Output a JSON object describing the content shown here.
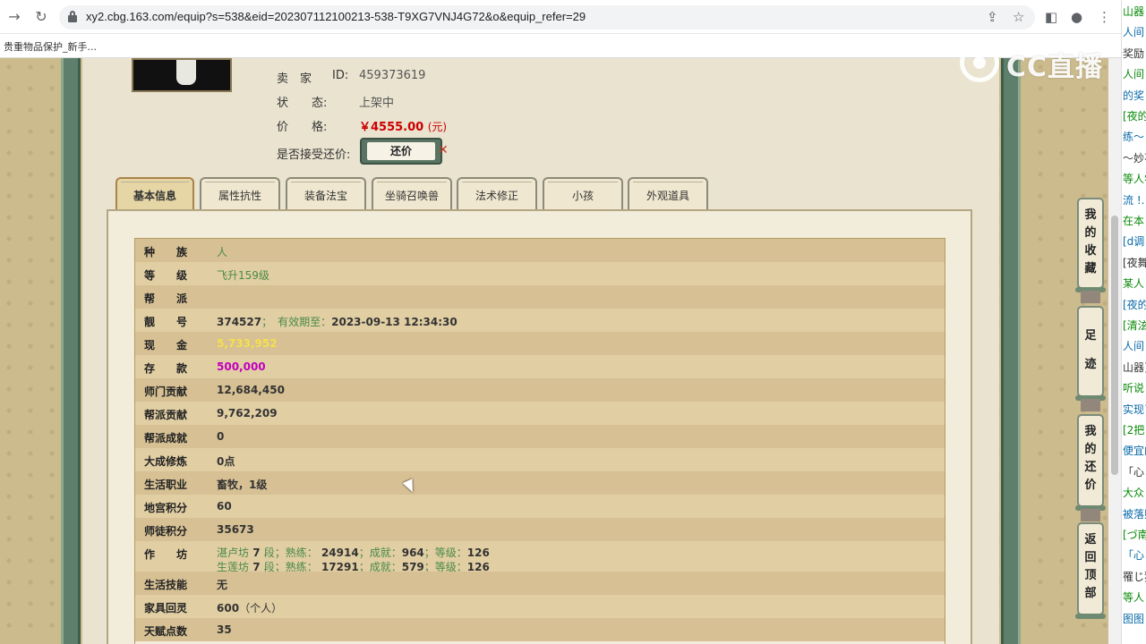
{
  "browser": {
    "url": "xy2.cbg.163.com/equip?s=538&eid=202307112100213-538-T9XG7VNJ4G72&o&equip_refer=29",
    "bookmark": "贵重物品保护_新手..."
  },
  "seller": {
    "seller_label": "卖　家",
    "id_label": "ID:",
    "id_value": "459373619",
    "status_label": "状　　态:",
    "status_value": "上架中",
    "price_label": "价　　格:",
    "price_value": "￥4555.00",
    "price_unit": "(元)",
    "counter_label": "是否接受还价:",
    "counter_button": "还价",
    "counter_x": "✕"
  },
  "tabs": [
    {
      "label": "基本信息",
      "active": true
    },
    {
      "label": "属性抗性"
    },
    {
      "label": "装备法宝"
    },
    {
      "label": "坐骑召唤兽"
    },
    {
      "label": "法术修正"
    },
    {
      "label": "小孩"
    },
    {
      "label": "外观道具"
    }
  ],
  "basic_info": {
    "race_label": "种　　族",
    "race_value": "人",
    "level_label": "等　　级",
    "level_value": "飞升159级",
    "guild_label": "帮　　派",
    "guild_value": "",
    "lucky_label": "靓　　号",
    "lucky_value": "374527",
    "lucky_valid_label": "；　有效期至：",
    "lucky_valid_value": "2023-09-13 12:34:30",
    "cash_label": "现　　金",
    "cash_value": "5,733,952",
    "deposit_label": "存　　款",
    "deposit_value": "500,000",
    "school_contrib_label": "师门贡献",
    "school_contrib_value": "12,684,450",
    "guild_contrib_label": "帮派贡献",
    "guild_contrib_value": "9,762,209",
    "guild_achieve_label": "帮派成就",
    "guild_achieve_value": "0",
    "cultivation_label": "大成修炼",
    "cultivation_value": "0点",
    "life_job_label": "生活职业",
    "life_job_value": "畜牧，1级",
    "palace_label": "地宫积分",
    "palace_value": "60",
    "mentor_label": "师徒积分",
    "mentor_value": "35673",
    "workshop_label": "作　　坊",
    "workshop_1": {
      "name": "湛卢坊",
      "level": "7",
      "duan": "段；熟练：",
      "skill": "24914",
      "ach_label": "；成就：",
      "ach": "964",
      "lv_label": "；等级：",
      "lv": "126"
    },
    "workshop_2": {
      "name": "生莲坊",
      "level": "7",
      "duan": "段；熟练：",
      "skill": "17291",
      "ach_label": "；成就：",
      "ach": "579",
      "lv_label": "；等级：",
      "lv": "126"
    },
    "life_skill_label": "生活技能",
    "life_skill_value": "无",
    "home_label": "家具回灵",
    "home_value": "600",
    "home_unit": "（个人）",
    "talent_label": "天赋点数",
    "talent_value": "35"
  },
  "side_buttons": {
    "fav": "我的收藏",
    "footprint": "足迹",
    "my_counter": "我的还价",
    "top": "返回顶部"
  },
  "logo": "CC直播",
  "chat_lines": [
    "山器",
    "人间",
    "奖励",
    "人间",
    "的奖",
    "[夜的",
    "练～",
    "～妙不",
    "等人学",
    "流 !.",
    "在本",
    "[d调",
    "[夜舞",
    "某人",
    "[夜的",
    "[清泫",
    "人间",
    "山器]",
    "听说",
    "实现了",
    "[2把",
    "便宜的",
    "「心",
    "大众",
    "被落则",
    "[づ南",
    "「心",
    "罹じ狗",
    "等人",
    "图图"
  ]
}
